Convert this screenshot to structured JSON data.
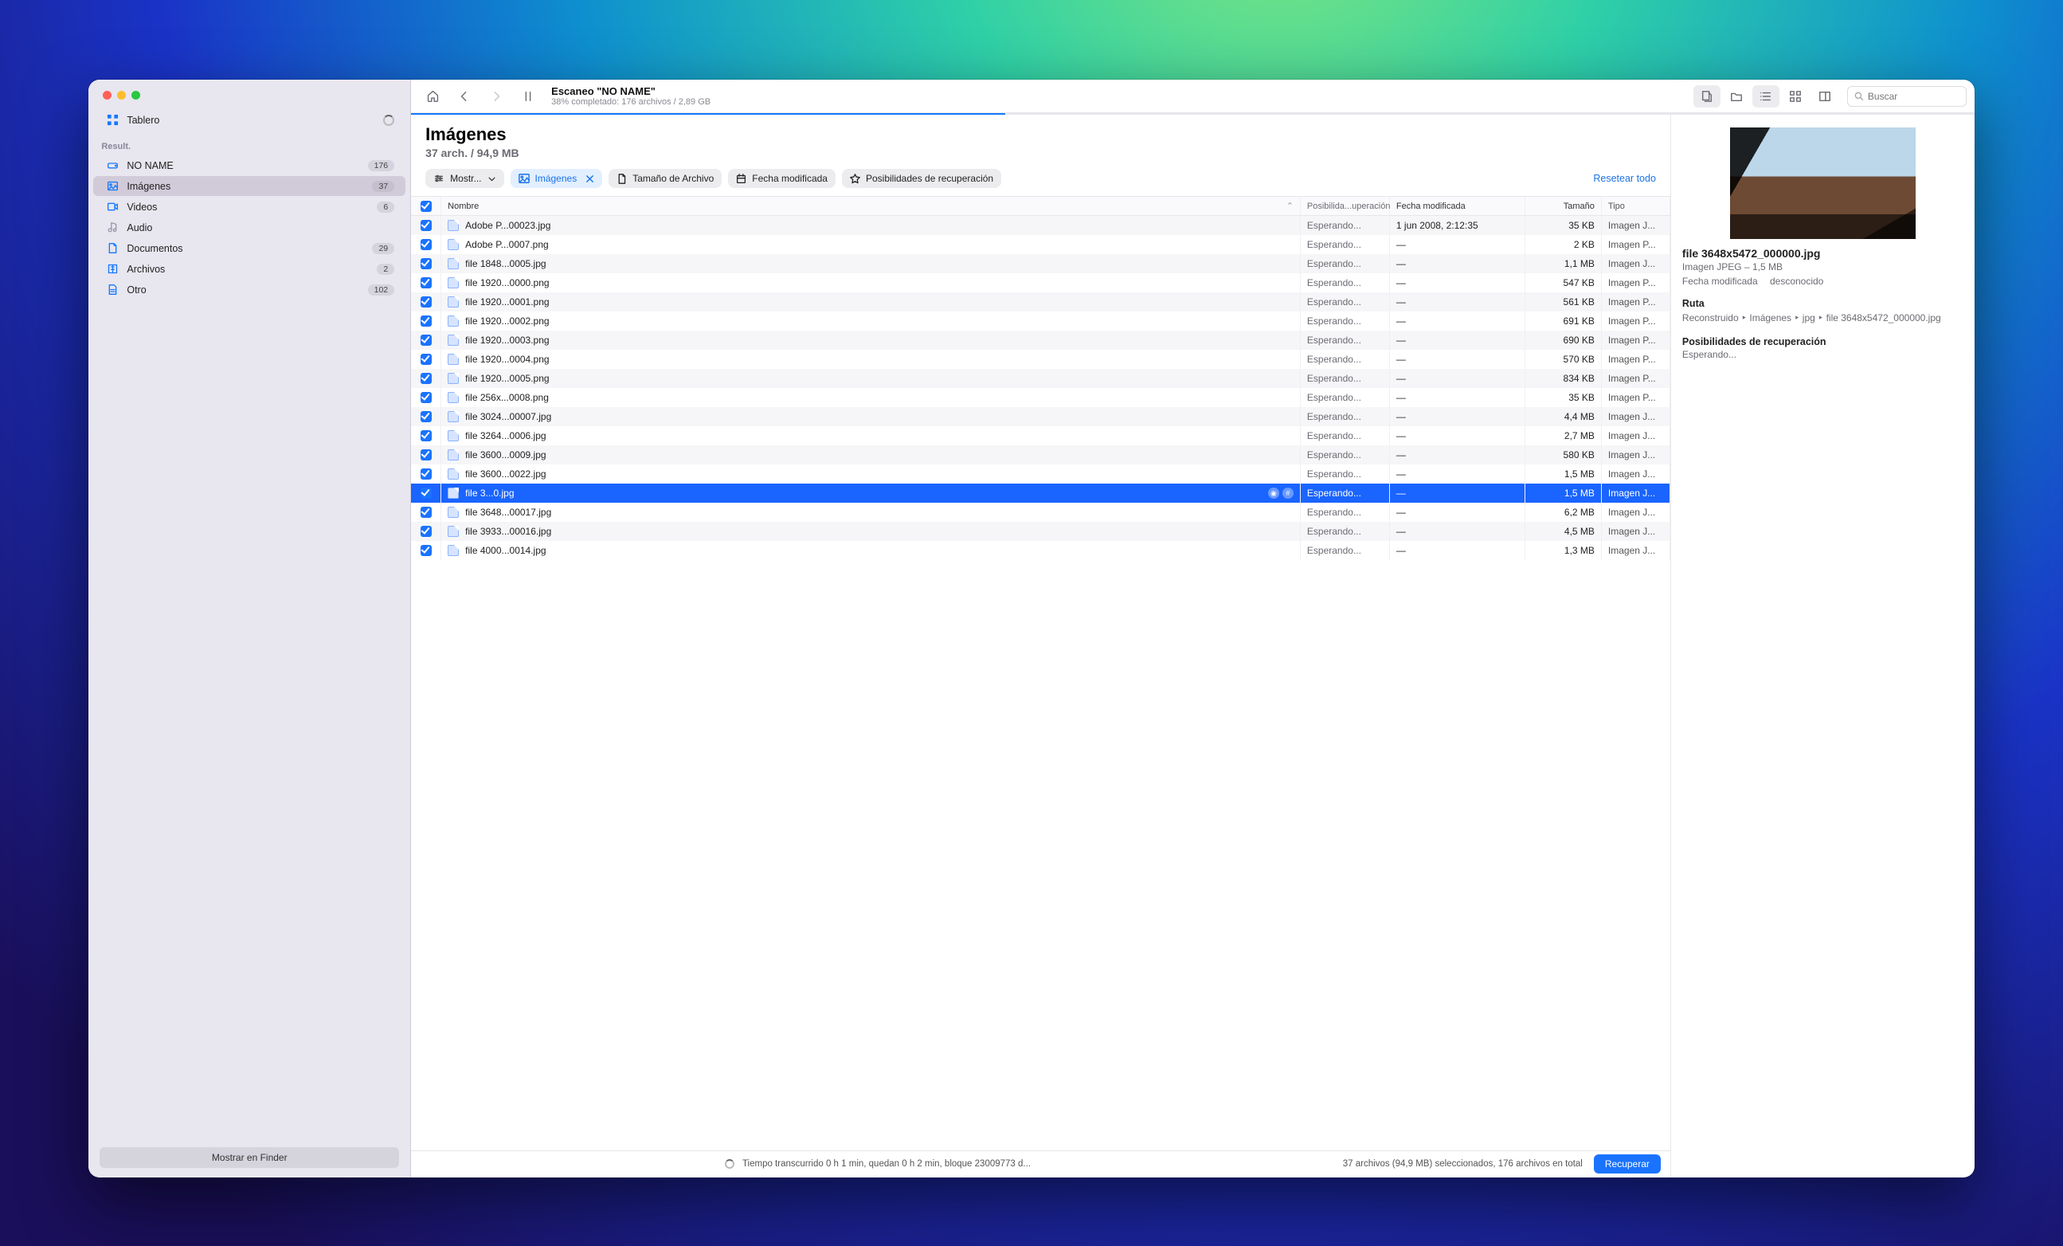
{
  "toolbar": {
    "title": "Escaneo \"NO NAME\"",
    "subtitle": "38% completado: 176 archivos / 2,89 GB",
    "progress_percent": 38,
    "search_placeholder": "Buscar"
  },
  "sidebar": {
    "board_label": "Tablero",
    "results_header": "Result.",
    "show_in_finder": "Mostrar en Finder",
    "items": [
      {
        "label": "NO NAME",
        "badge": "176",
        "icon": "drive"
      },
      {
        "label": "Imágenes",
        "badge": "37",
        "icon": "image",
        "selected": true
      },
      {
        "label": "Videos",
        "badge": "6",
        "icon": "video"
      },
      {
        "label": "Audio",
        "badge": "",
        "icon": "audio"
      },
      {
        "label": "Documentos",
        "badge": "29",
        "icon": "doc"
      },
      {
        "label": "Archivos",
        "badge": "2",
        "icon": "archive"
      },
      {
        "label": "Otro",
        "badge": "102",
        "icon": "other"
      }
    ]
  },
  "content": {
    "heading": "Imágenes",
    "subheading": "37 arch. / 94,9 MB",
    "filter_show": "Mostr...",
    "chip_images": "Imágenes",
    "pill_size": "Tamaño de Archivo",
    "pill_date": "Fecha modificada",
    "pill_recovery": "Posibilidades de recuperación",
    "reset_link": "Resetear todo",
    "columns": {
      "name": "Nombre",
      "prob": "Posibilida...uperación",
      "date": "Fecha modificada",
      "size": "Tamaño",
      "type": "Tipo"
    },
    "rows": [
      {
        "name": "Adobe P...00023.jpg",
        "prob": "Esperando...",
        "date": "1 jun 2008, 2:12:35",
        "size": "35 KB",
        "type": "Imagen J..."
      },
      {
        "name": "Adobe P...0007.png",
        "prob": "Esperando...",
        "date": "—",
        "size": "2 KB",
        "type": "Imagen P..."
      },
      {
        "name": "file 1848...0005.jpg",
        "prob": "Esperando...",
        "date": "—",
        "size": "1,1 MB",
        "type": "Imagen J..."
      },
      {
        "name": "file 1920...0000.png",
        "prob": "Esperando...",
        "date": "—",
        "size": "547 KB",
        "type": "Imagen P..."
      },
      {
        "name": "file 1920...0001.png",
        "prob": "Esperando...",
        "date": "—",
        "size": "561 KB",
        "type": "Imagen P..."
      },
      {
        "name": "file 1920...0002.png",
        "prob": "Esperando...",
        "date": "—",
        "size": "691 KB",
        "type": "Imagen P..."
      },
      {
        "name": "file 1920...0003.png",
        "prob": "Esperando...",
        "date": "—",
        "size": "690 KB",
        "type": "Imagen P..."
      },
      {
        "name": "file 1920...0004.png",
        "prob": "Esperando...",
        "date": "—",
        "size": "570 KB",
        "type": "Imagen P..."
      },
      {
        "name": "file 1920...0005.png",
        "prob": "Esperando...",
        "date": "—",
        "size": "834 KB",
        "type": "Imagen P..."
      },
      {
        "name": "file 256x...0008.png",
        "prob": "Esperando...",
        "date": "—",
        "size": "35 KB",
        "type": "Imagen P..."
      },
      {
        "name": "file 3024...00007.jpg",
        "prob": "Esperando...",
        "date": "—",
        "size": "4,4 MB",
        "type": "Imagen J..."
      },
      {
        "name": "file 3264...0006.jpg",
        "prob": "Esperando...",
        "date": "—",
        "size": "2,7 MB",
        "type": "Imagen J..."
      },
      {
        "name": "file 3600...0009.jpg",
        "prob": "Esperando...",
        "date": "—",
        "size": "580 KB",
        "type": "Imagen J..."
      },
      {
        "name": "file 3600...0022.jpg",
        "prob": "Esperando...",
        "date": "—",
        "size": "1,5 MB",
        "type": "Imagen J..."
      },
      {
        "name": "file 3...0.jpg",
        "prob": "Esperando...",
        "date": "—",
        "size": "1,5 MB",
        "type": "Imagen J...",
        "selected": true,
        "tags": true
      },
      {
        "name": "file 3648...00017.jpg",
        "prob": "Esperando...",
        "date": "—",
        "size": "6,2 MB",
        "type": "Imagen J..."
      },
      {
        "name": "file 3933...00016.jpg",
        "prob": "Esperando...",
        "date": "—",
        "size": "4,5 MB",
        "type": "Imagen J..."
      },
      {
        "name": "file 4000...0014.jpg",
        "prob": "Esperando...",
        "date": "—",
        "size": "1,3 MB",
        "type": "Imagen J..."
      }
    ]
  },
  "footer": {
    "status": "Tiempo transcurrido 0 h 1 min, quedan 0 h 2 min, bloque 23009773 d...",
    "selection": "37 archivos (94,9 MB) seleccionados, 176 archivos en total",
    "recover_btn": "Recuperar"
  },
  "details": {
    "title": "file 3648x5472_000000.jpg",
    "subtitle": "Imagen JPEG – 1,5 MB",
    "date_label": "Fecha modificada",
    "date_value": "desconocido",
    "path_header": "Ruta",
    "path_value": "Reconstruido ‣ Imágenes ‣ jpg ‣ file 3648x5472_000000.jpg",
    "recovery_header": "Posibilidades de recuperación",
    "recovery_value": "Esperando..."
  }
}
